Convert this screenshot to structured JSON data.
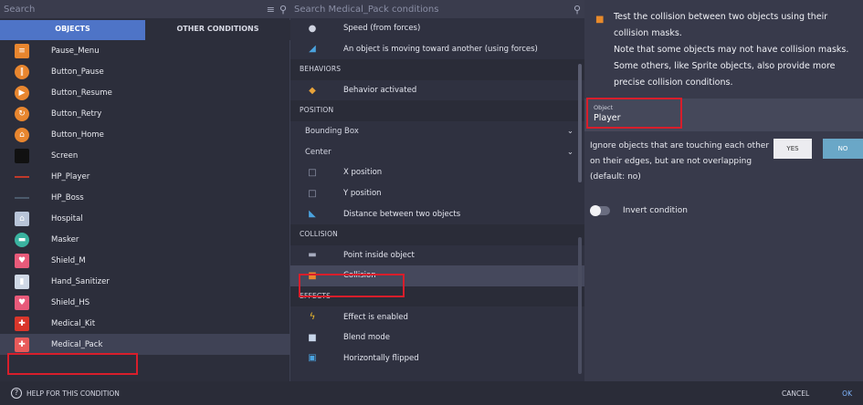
{
  "left": {
    "search_placeholder": "Search",
    "tabs": [
      "OBJECTS",
      "OTHER CONDITIONS"
    ],
    "objects": [
      {
        "label": "Pause_Menu",
        "icon": "menu-icon",
        "color": "#e8862f"
      },
      {
        "label": "Button_Pause",
        "icon": "pause-icon",
        "color": "#e8862f"
      },
      {
        "label": "Button_Resume",
        "icon": "play-icon",
        "color": "#e8862f"
      },
      {
        "label": "Button_Retry",
        "icon": "retry-icon",
        "color": "#e8862f"
      },
      {
        "label": "Button_Home",
        "icon": "home-icon",
        "color": "#e8862f"
      },
      {
        "label": "Screen",
        "icon": "screen-icon",
        "color": "#111111"
      },
      {
        "label": "HP_Player",
        "icon": "bar-icon",
        "color": "#c0392b"
      },
      {
        "label": "HP_Boss",
        "icon": "bar-icon",
        "color": "#4b5a6b"
      },
      {
        "label": "Hospital",
        "icon": "hospital-icon",
        "color": "#b8c4d8"
      },
      {
        "label": "Masker",
        "icon": "mask-icon",
        "color": "#3ab3a0"
      },
      {
        "label": "Shield_M",
        "icon": "shield-icon",
        "color": "#e85a7a"
      },
      {
        "label": "Hand_Sanitizer",
        "icon": "bottle-icon",
        "color": "#cfd8e6"
      },
      {
        "label": "Shield_HS",
        "icon": "shield-icon",
        "color": "#e85a7a"
      },
      {
        "label": "Medical_Kit",
        "icon": "kit-icon",
        "color": "#d9362b"
      },
      {
        "label": "Medical_Pack",
        "icon": "pack-icon",
        "color": "#e85a5a"
      }
    ]
  },
  "middle": {
    "search_placeholder": "Search Medical_Pack conditions",
    "rows": [
      {
        "kind": "item",
        "label": "Speed (from forces)",
        "icon": "speed-icon"
      },
      {
        "kind": "item",
        "label": "An object is moving toward another (using forces)",
        "icon": "move-icon"
      },
      {
        "kind": "header",
        "label": "BEHAVIORS"
      },
      {
        "kind": "item",
        "label": "Behavior activated",
        "icon": "behavior-icon"
      },
      {
        "kind": "header",
        "label": "POSITION"
      },
      {
        "kind": "drop",
        "label": "Bounding Box"
      },
      {
        "kind": "drop",
        "label": "Center"
      },
      {
        "kind": "item",
        "label": "X position",
        "icon": "x-position-icon"
      },
      {
        "kind": "item",
        "label": "Y position",
        "icon": "y-position-icon"
      },
      {
        "kind": "item",
        "label": "Distance between two objects",
        "icon": "distance-icon"
      },
      {
        "kind": "header",
        "label": "COLLISION"
      },
      {
        "kind": "item",
        "label": "Point inside object",
        "icon": "point-icon"
      },
      {
        "kind": "item",
        "label": "Collision",
        "icon": "collision-icon",
        "selected": true
      },
      {
        "kind": "header",
        "label": "EFFECTS"
      },
      {
        "kind": "item",
        "label": "Effect is enabled",
        "icon": "effect-icon"
      },
      {
        "kind": "item",
        "label": "Blend mode",
        "icon": "blend-icon"
      },
      {
        "kind": "item",
        "label": "Horizontally flipped",
        "icon": "flip-icon"
      }
    ]
  },
  "right": {
    "description": "Test the collision between two objects using their collision masks.\nNote that some objects may not have collision masks.\nSome others, like Sprite objects, also provide more precise collision conditions.",
    "object_label": "Object",
    "object_value": "Player",
    "ignore_text": "Ignore objects that are touching each other on their edges, but are not overlapping (default: no)",
    "yes_label": "YES",
    "no_label": "NO",
    "invert_label": "Invert condition"
  },
  "bottom": {
    "help_label": "HELP FOR THIS CONDITION",
    "cancel_label": "CANCEL",
    "ok_label": "OK"
  }
}
